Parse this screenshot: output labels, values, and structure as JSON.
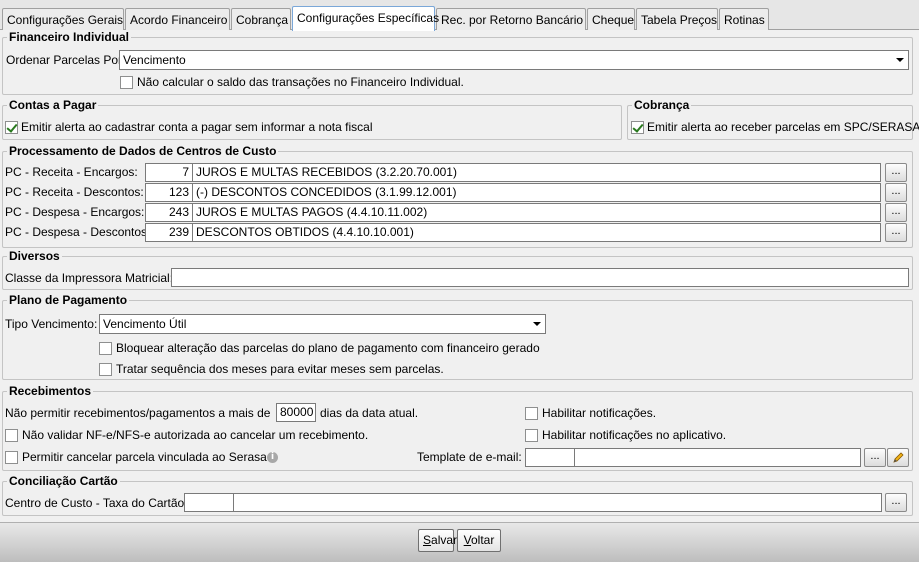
{
  "tabs": [
    {
      "label": "Configurações Gerais"
    },
    {
      "label": "Acordo Financeiro"
    },
    {
      "label": "Cobrança"
    },
    {
      "label": "Configurações Específicas"
    },
    {
      "label": "Rec. por Retorno Bancário"
    },
    {
      "label": "Cheque"
    },
    {
      "label": "Tabela Preços"
    },
    {
      "label": "Rotinas"
    }
  ],
  "financeiro": {
    "legend": "Financeiro Individual",
    "ordenar_label": "Ordenar Parcelas Por:",
    "ordenar_value": "Vencimento",
    "nao_calcular": {
      "label": "Não calcular o saldo das transações no Financeiro Individual.",
      "checked": false
    }
  },
  "contas_pagar": {
    "legend": "Contas a Pagar",
    "alerta": {
      "label": "Emitir alerta ao cadastrar conta a pagar sem informar a nota fiscal",
      "checked": true
    }
  },
  "cobranca": {
    "legend": "Cobrança",
    "alerta": {
      "label": "Emitir alerta ao receber parcelas em SPC/SERASA",
      "checked": true
    }
  },
  "processamento": {
    "legend": "Processamento de Dados de Centros de Custo",
    "rows": [
      {
        "label": "PC - Receita - Encargos:",
        "code": "7",
        "desc": "JUROS E MULTAS RECEBIDOS (3.2.20.70.001)"
      },
      {
        "label": "PC - Receita - Descontos:",
        "code": "123",
        "desc": "(-) DESCONTOS CONCEDIDOS (3.1.99.12.001)"
      },
      {
        "label": "PC - Despesa - Encargos:",
        "code": "243",
        "desc": "JUROS E MULTAS PAGOS (4.4.10.11.002)"
      },
      {
        "label": "PC - Despesa - Descontos:",
        "code": "239",
        "desc": "DESCONTOS OBTIDOS (4.4.10.10.001)"
      }
    ],
    "lookup_label": "..."
  },
  "diversos": {
    "legend": "Diversos",
    "impressora_label": "Classe da Impressora Matricial:",
    "impressora_value": ""
  },
  "plano": {
    "legend": "Plano de Pagamento",
    "tipo_label": "Tipo Vencimento:",
    "tipo_value": "Vencimento Útil",
    "bloquear": {
      "label": "Bloquear alteração das parcelas do plano de pagamento com financeiro gerado",
      "checked": false
    },
    "tratar": {
      "label": "Tratar sequência dos meses para evitar meses sem parcelas.",
      "checked": false
    }
  },
  "recebimentos": {
    "legend": "Recebimentos",
    "nao_permitir_pre": "Não permitir recebimentos/pagamentos a mais de",
    "dias_value": "80000",
    "nao_permitir_pos": "dias da data atual.",
    "nao_validar": {
      "label": "Não validar NF-e/NFS-e autorizada ao cancelar um recebimento.",
      "checked": false
    },
    "permitir_cancelar": {
      "label": "Permitir cancelar parcela vinculada ao Serasa",
      "checked": false
    },
    "habilitar_notif": {
      "label": "Habilitar notificações.",
      "checked": false
    },
    "habilitar_notif_app": {
      "label": "Habilitar notificações no aplicativo.",
      "checked": false
    },
    "template_label": "Template de e-mail:",
    "template_code": "",
    "template_desc": ""
  },
  "conciliacao": {
    "legend": "Conciliação Cartão",
    "centro_label": "Centro de Custo - Taxa do Cartão",
    "centro_code": "",
    "centro_desc": ""
  },
  "footer": {
    "salvar_first": "S",
    "salvar_rest": "alvar",
    "voltar_first": "V",
    "voltar_rest": "oltar"
  },
  "icons": {
    "info": "i"
  }
}
